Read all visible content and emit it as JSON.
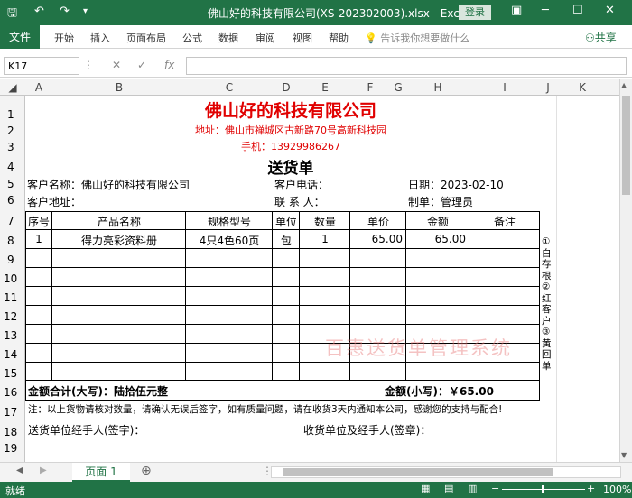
{
  "titlebar": {
    "title": "佛山好的科技有限公司(XS-202302003).xlsx  -  Excel",
    "login": "登录",
    "save_icon": "save-icon",
    "undo_icon": "undo-icon",
    "redo_icon": "redo-icon"
  },
  "ribbon": {
    "file": "文件",
    "tabs": [
      "开始",
      "插入",
      "页面布局",
      "公式",
      "数据",
      "审阅",
      "视图",
      "帮助"
    ],
    "tell_me": "告诉我你想要做什么",
    "share": "共享"
  },
  "formula_bar": {
    "cell": "K17",
    "value": ""
  },
  "columns": [
    "A",
    "B",
    "C",
    "D",
    "E",
    "F",
    "G",
    "H",
    "I",
    "J",
    "K"
  ],
  "rows": [
    "1",
    "2",
    "3",
    "4",
    "5",
    "6",
    "7",
    "8",
    "9",
    "10",
    "11",
    "12",
    "13",
    "14",
    "15",
    "16",
    "17",
    "18",
    "19"
  ],
  "doc": {
    "company": "佛山好的科技有限公司",
    "address": "地址：佛山市禅城区古新路70号高新科技园",
    "phone": "手机：13929986267",
    "doc_title": "送货单",
    "customer_name_label": "客户名称：佛山好的科技有限公司",
    "customer_phone_label": "客户电话：",
    "date_label": "日期：2023-02-10",
    "customer_address_label": "客户地址：",
    "contact_label": "联  系  人：",
    "maker_label": "制单：管理员",
    "headers": [
      "序号",
      "产品名称",
      "规格型号",
      "单位",
      "数量",
      "单价",
      "金额",
      "备注"
    ],
    "items": [
      {
        "no": "1",
        "name": "得力亮彩资料册",
        "spec": "4只4色60页",
        "unit": "包",
        "qty": "1",
        "price": "65.00",
        "amount": "65.00",
        "note": ""
      }
    ],
    "total_upper": "金额合计(大写)：陆拾伍元整",
    "total_lower": "金额(小写)：￥65.00",
    "note": "注：以上货物请核对数量，请确认无误后签字，如有质量问题，请在收货3天内通知本公司，感谢您的支持与配合!",
    "sender_sign": "送货单位经手人(签字)：",
    "receiver_sign": "收货单位及经手人(签章)：",
    "side_note": "①白存根②红客户③黄回单",
    "watermark": "百惠送货单管理系统"
  },
  "sheet_tab": "页面 1",
  "status": {
    "ready": "就绪",
    "zoom": "100%"
  }
}
